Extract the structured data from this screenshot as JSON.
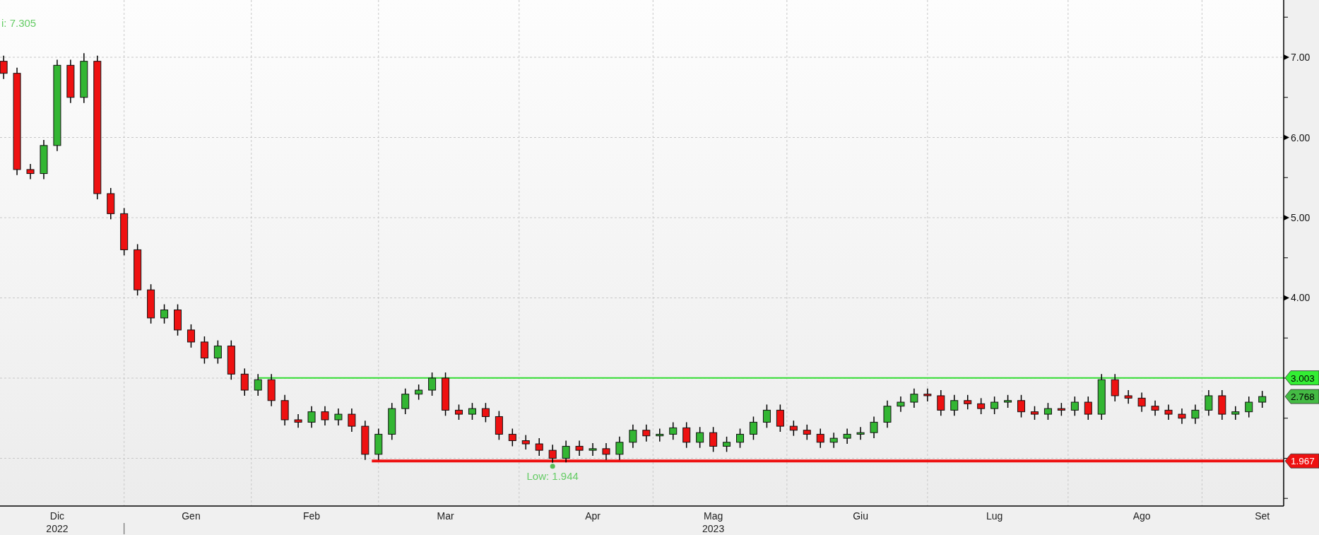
{
  "chart_data": {
    "type": "candlestick",
    "grid": true,
    "ylim": [
      1.405,
      7.714
    ],
    "yticks": [
      {
        "value": 4,
        "label": "4.00"
      },
      {
        "value": 5,
        "label": "5.00"
      },
      {
        "value": 6,
        "label": "6.00"
      },
      {
        "value": 7,
        "label": "7.00"
      }
    ],
    "categories": [
      null,
      null,
      null,
      null,
      "Dic\n2022",
      null,
      null,
      null,
      null,
      null,
      null,
      null,
      null,
      null,
      "Gen",
      null,
      null,
      null,
      null,
      null,
      null,
      null,
      null,
      "Feb",
      null,
      null,
      null,
      null,
      null,
      null,
      null,
      null,
      null,
      "Mar",
      null,
      null,
      null,
      null,
      null,
      null,
      null,
      null,
      null,
      null,
      "Apr",
      null,
      null,
      null,
      null,
      null,
      null,
      null,
      null,
      "Mag\n2023",
      null,
      null,
      null,
      null,
      null,
      null,
      null,
      null,
      null,
      null,
      "Giu",
      null,
      null,
      null,
      null,
      null,
      null,
      null,
      null,
      null,
      "Lug",
      null,
      null,
      null,
      null,
      null,
      null,
      null,
      null,
      null,
      null,
      "Ago",
      null,
      null,
      null,
      null,
      null,
      null,
      null,
      null,
      "Set"
    ],
    "ohlc": [
      [
        6.95,
        7.02,
        6.73,
        6.8
      ],
      [
        6.8,
        6.87,
        5.53,
        5.6
      ],
      [
        5.6,
        5.67,
        5.48,
        5.55
      ],
      [
        5.55,
        5.97,
        5.48,
        5.9
      ],
      [
        5.9,
        6.97,
        5.83,
        6.9
      ],
      [
        6.9,
        6.97,
        6.43,
        6.5
      ],
      [
        6.5,
        7.05,
        6.43,
        6.95
      ],
      [
        6.95,
        7.02,
        5.23,
        5.3
      ],
      [
        5.3,
        5.37,
        4.98,
        5.05
      ],
      [
        5.05,
        5.12,
        4.53,
        4.6
      ],
      [
        4.6,
        4.67,
        4.03,
        4.1
      ],
      [
        4.1,
        4.17,
        3.68,
        3.75
      ],
      [
        3.75,
        3.92,
        3.68,
        3.85
      ],
      [
        3.85,
        3.92,
        3.53,
        3.6
      ],
      [
        3.6,
        3.67,
        3.38,
        3.45
      ],
      [
        3.45,
        3.52,
        3.18,
        3.25
      ],
      [
        3.25,
        3.47,
        3.18,
        3.4
      ],
      [
        3.4,
        3.47,
        2.98,
        3.05
      ],
      [
        3.05,
        3.12,
        2.78,
        2.85
      ],
      [
        2.85,
        3.05,
        2.78,
        2.98
      ],
      [
        2.98,
        3.05,
        2.65,
        2.72
      ],
      [
        2.72,
        2.79,
        2.41,
        2.48
      ],
      [
        2.48,
        2.55,
        2.38,
        2.45
      ],
      [
        2.45,
        2.65,
        2.38,
        2.58
      ],
      [
        2.58,
        2.65,
        2.41,
        2.48
      ],
      [
        2.48,
        2.62,
        2.41,
        2.55
      ],
      [
        2.55,
        2.62,
        2.33,
        2.4
      ],
      [
        2.4,
        2.47,
        1.98,
        2.05
      ],
      [
        2.05,
        2.37,
        1.98,
        2.3
      ],
      [
        2.3,
        2.69,
        2.23,
        2.62
      ],
      [
        2.62,
        2.87,
        2.55,
        2.8
      ],
      [
        2.8,
        2.92,
        2.73,
        2.85
      ],
      [
        2.85,
        3.07,
        2.78,
        3.0
      ],
      [
        3.0,
        3.07,
        2.53,
        2.6
      ],
      [
        2.6,
        2.67,
        2.48,
        2.55
      ],
      [
        2.55,
        2.69,
        2.48,
        2.62
      ],
      [
        2.62,
        2.69,
        2.45,
        2.52
      ],
      [
        2.52,
        2.59,
        2.23,
        2.3
      ],
      [
        2.3,
        2.37,
        2.15,
        2.22
      ],
      [
        2.22,
        2.29,
        2.11,
        2.18
      ],
      [
        2.18,
        2.25,
        2.03,
        2.1
      ],
      [
        2.1,
        2.17,
        1.944,
        2.0
      ],
      [
        2.0,
        2.22,
        1.95,
        2.15
      ],
      [
        2.15,
        2.22,
        2.03,
        2.1
      ],
      [
        2.1,
        2.19,
        2.03,
        2.12
      ],
      [
        2.12,
        2.19,
        1.98,
        2.05
      ],
      [
        2.05,
        2.27,
        1.98,
        2.2
      ],
      [
        2.2,
        2.42,
        2.13,
        2.35
      ],
      [
        2.35,
        2.42,
        2.21,
        2.28
      ],
      [
        2.28,
        2.37,
        2.21,
        2.3
      ],
      [
        2.3,
        2.45,
        2.23,
        2.38
      ],
      [
        2.38,
        2.45,
        2.13,
        2.2
      ],
      [
        2.2,
        2.39,
        2.13,
        2.32
      ],
      [
        2.32,
        2.39,
        2.08,
        2.15
      ],
      [
        2.15,
        2.27,
        2.08,
        2.2
      ],
      [
        2.2,
        2.37,
        2.13,
        2.3
      ],
      [
        2.3,
        2.52,
        2.23,
        2.45
      ],
      [
        2.45,
        2.67,
        2.38,
        2.6
      ],
      [
        2.6,
        2.67,
        2.33,
        2.4
      ],
      [
        2.4,
        2.47,
        2.28,
        2.35
      ],
      [
        2.35,
        2.42,
        2.23,
        2.3
      ],
      [
        2.3,
        2.37,
        2.13,
        2.2
      ],
      [
        2.2,
        2.32,
        2.13,
        2.25
      ],
      [
        2.25,
        2.37,
        2.18,
        2.3
      ],
      [
        2.3,
        2.39,
        2.23,
        2.32
      ],
      [
        2.32,
        2.52,
        2.25,
        2.45
      ],
      [
        2.45,
        2.72,
        2.38,
        2.65
      ],
      [
        2.65,
        2.77,
        2.58,
        2.7
      ],
      [
        2.7,
        2.87,
        2.63,
        2.8
      ],
      [
        2.8,
        2.87,
        2.71,
        2.78
      ],
      [
        2.78,
        2.85,
        2.53,
        2.6
      ],
      [
        2.6,
        2.79,
        2.53,
        2.72
      ],
      [
        2.72,
        2.79,
        2.61,
        2.68
      ],
      [
        2.68,
        2.75,
        2.55,
        2.62
      ],
      [
        2.62,
        2.77,
        2.55,
        2.7
      ],
      [
        2.7,
        2.79,
        2.63,
        2.72
      ],
      [
        2.72,
        2.79,
        2.51,
        2.58
      ],
      [
        2.58,
        2.65,
        2.48,
        2.55
      ],
      [
        2.55,
        2.69,
        2.48,
        2.62
      ],
      [
        2.62,
        2.69,
        2.53,
        2.6
      ],
      [
        2.6,
        2.77,
        2.53,
        2.7
      ],
      [
        2.7,
        2.77,
        2.48,
        2.55
      ],
      [
        2.55,
        3.05,
        2.48,
        2.98
      ],
      [
        2.98,
        3.05,
        2.71,
        2.78
      ],
      [
        2.78,
        2.85,
        2.68,
        2.75
      ],
      [
        2.75,
        2.82,
        2.58,
        2.65
      ],
      [
        2.65,
        2.72,
        2.53,
        2.6
      ],
      [
        2.6,
        2.67,
        2.48,
        2.55
      ],
      [
        2.55,
        2.62,
        2.43,
        2.5
      ],
      [
        2.5,
        2.67,
        2.43,
        2.6
      ],
      [
        2.6,
        2.85,
        2.53,
        2.78
      ],
      [
        2.78,
        2.85,
        2.48,
        2.55
      ],
      [
        2.55,
        2.65,
        2.48,
        2.58
      ],
      [
        2.58,
        2.77,
        2.51,
        2.7
      ],
      [
        2.7,
        2.84,
        2.63,
        2.77
      ]
    ],
    "ref_lines": [
      {
        "axis": "y",
        "value": 3.003,
        "label": "3.003"
      },
      {
        "axis": "y",
        "value": 1.967,
        "label": "1.967"
      }
    ],
    "annotations": [
      "i: 7.305",
      "Low: 1.944",
      "2.768"
    ]
  }
}
